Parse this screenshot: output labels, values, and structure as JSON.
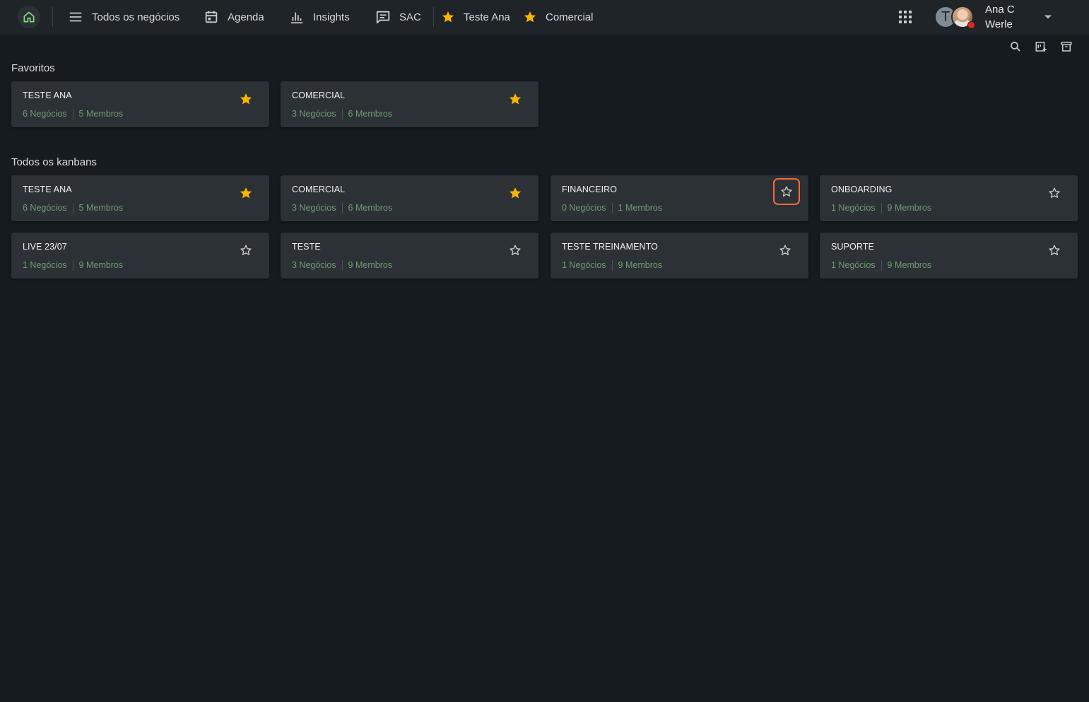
{
  "nav": {
    "items": [
      {
        "label": "Todos os negócios",
        "icon": "menu-icon"
      },
      {
        "label": "Agenda",
        "icon": "calendar-icon"
      },
      {
        "label": "Insights",
        "icon": "bar-chart-icon"
      },
      {
        "label": "SAC",
        "icon": "chat-icon"
      }
    ],
    "favorites": [
      {
        "label": "Teste Ana",
        "icon": "star-filled-icon"
      },
      {
        "label": "Comercial",
        "icon": "star-filled-icon"
      }
    ]
  },
  "user": {
    "initial": "T",
    "name": "Ana C Werle",
    "status_color": "#e52222"
  },
  "colors": {
    "background": "#161b1f",
    "topbar": "#1f2428",
    "card": "#2c3135",
    "star": "#f7b500",
    "meta_text": "#6f9a72",
    "focus": "#f26b3a"
  },
  "sections": {
    "favorites_title": "Favoritos",
    "all_title": "Todos os kanbans"
  },
  "favorites": [
    {
      "title": "TESTE ANA",
      "deals": "6 Negócios",
      "members": "5 Membros",
      "starred": true
    },
    {
      "title": "COMERCIAL",
      "deals": "3 Negócios",
      "members": "6 Membros",
      "starred": true
    }
  ],
  "kanbans": [
    {
      "title": "TESTE ANA",
      "deals": "6 Negócios",
      "members": "5 Membros",
      "starred": true
    },
    {
      "title": "COMERCIAL",
      "deals": "3 Negócios",
      "members": "6 Membros",
      "starred": true
    },
    {
      "title": "FINANCEIRO",
      "deals": "0 Negócios",
      "members": "1 Membros",
      "starred": false,
      "focused": true
    },
    {
      "title": "ONBOARDING",
      "deals": "1 Negócios",
      "members": "9 Membros",
      "starred": false
    },
    {
      "title": "LIVE 23/07",
      "deals": "1 Negócios",
      "members": "9 Membros",
      "starred": false
    },
    {
      "title": "TESTE",
      "deals": "3 Negócios",
      "members": "9 Membros",
      "starred": false
    },
    {
      "title": "TESTE TREINAMENTO",
      "deals": "1 Negócios",
      "members": "9 Membros",
      "starred": false
    },
    {
      "title": "SUPORTE",
      "deals": "1 Negócios",
      "members": "9 Membros",
      "starred": false
    }
  ]
}
